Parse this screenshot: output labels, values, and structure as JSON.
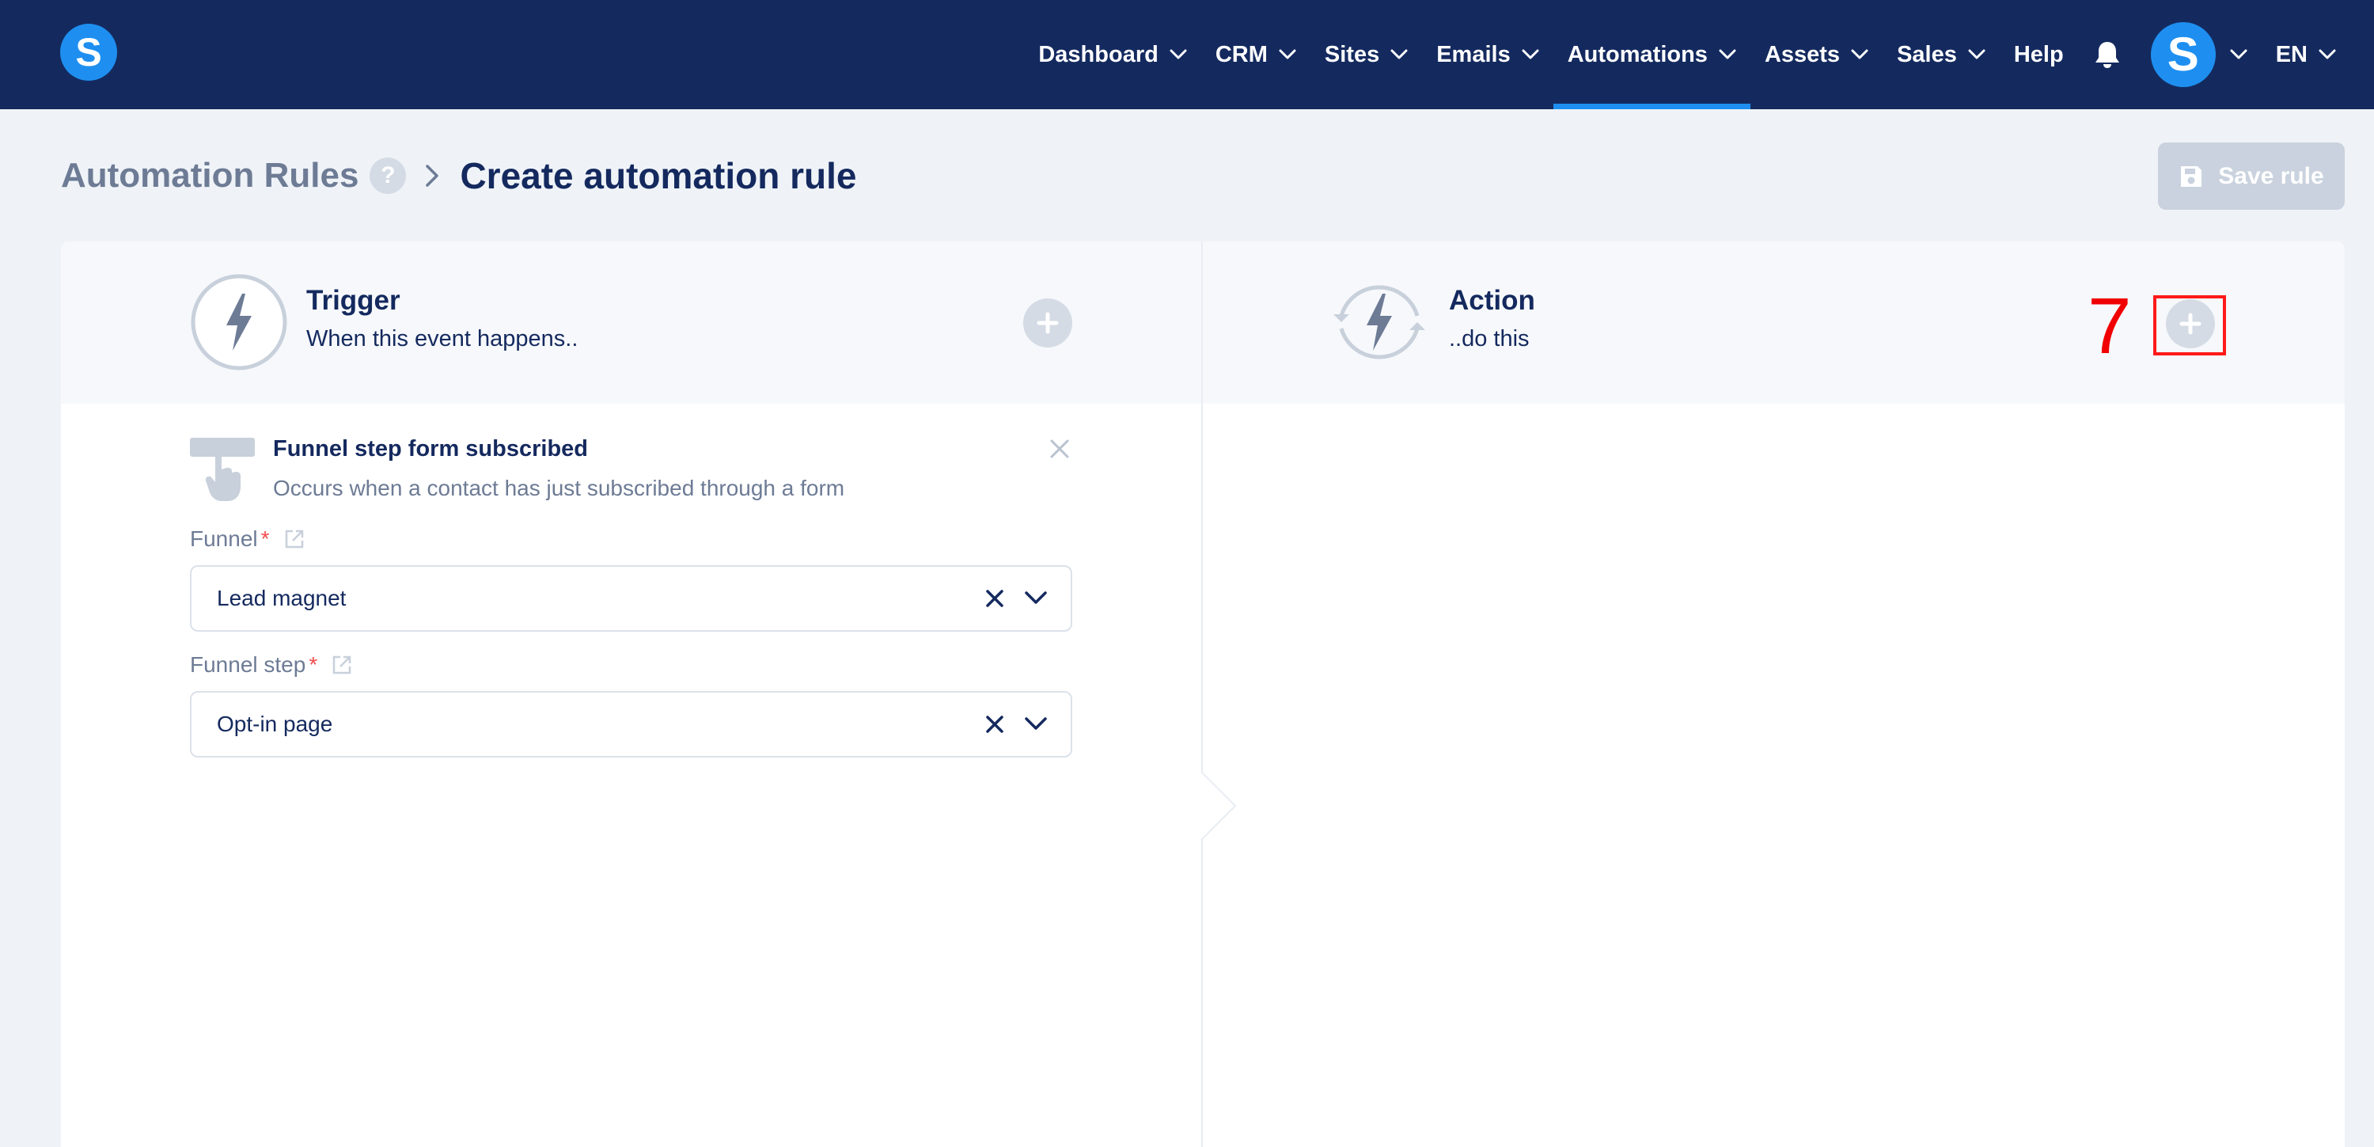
{
  "brand": {
    "logo_letter": "S"
  },
  "nav": {
    "items": [
      {
        "label": "Dashboard",
        "has_dropdown": true,
        "active": false
      },
      {
        "label": "CRM",
        "has_dropdown": true,
        "active": false
      },
      {
        "label": "Sites",
        "has_dropdown": true,
        "active": false
      },
      {
        "label": "Emails",
        "has_dropdown": true,
        "active": false
      },
      {
        "label": "Automations",
        "has_dropdown": true,
        "active": true
      },
      {
        "label": "Assets",
        "has_dropdown": true,
        "active": false
      },
      {
        "label": "Sales",
        "has_dropdown": true,
        "active": false
      },
      {
        "label": "Help",
        "has_dropdown": false,
        "active": false
      }
    ],
    "avatar_letter": "S",
    "language": "EN"
  },
  "header": {
    "breadcrumb_parent": "Automation Rules",
    "help_symbol": "?",
    "title": "Create automation rule",
    "save_label": "Save rule"
  },
  "trigger": {
    "title": "Trigger",
    "subtitle": "When this event happens..",
    "item": {
      "name": "Funnel step form subscribed",
      "description": "Occurs when a contact has just subscribed through a form"
    },
    "fields": [
      {
        "label": "Funnel",
        "required_mark": "*",
        "value": "Lead magnet"
      },
      {
        "label": "Funnel step",
        "required_mark": "*",
        "value": "Opt-in page"
      }
    ]
  },
  "action": {
    "title": "Action",
    "subtitle": "..do this"
  },
  "annotation": {
    "marker_number": "7"
  },
  "colors": {
    "navbar": "#142a5f",
    "accent": "#1e8ff0",
    "page_bg": "#eff3f7",
    "text_dark": "#14295e",
    "text_muted": "#6d7b95",
    "disabled_button": "#c9d2de",
    "marker_red": "#ff0000"
  },
  "icons": {
    "nav_dropdown": "chevron-down-icon",
    "notifications": "bell-icon",
    "breadcrumb_separator": "chevron-right-icon",
    "save": "floppy-disk-icon",
    "trigger": "lightning-bolt-icon",
    "action": "lightning-bolt-cycle-icon",
    "add": "plus-circle-icon",
    "trigger_item": "hand-pointer-form-icon",
    "remove": "close-icon",
    "external_link": "external-link-icon",
    "select_clear": "x-icon",
    "select_open": "chevron-down-icon"
  }
}
